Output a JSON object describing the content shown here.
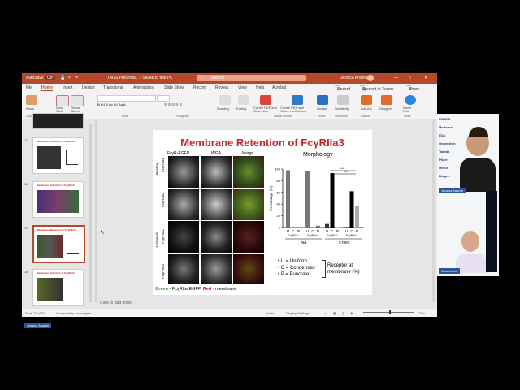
{
  "titlebar": {
    "autosave_label": "AutoSave",
    "autosave_state": "Off",
    "doc_title": "TAGS Presenta... • Saved to this PC",
    "search_placeholder": "Search",
    "user_name": "Jessica Anania"
  },
  "tabs": [
    "File",
    "Home",
    "Insert",
    "Design",
    "Transitions",
    "Animations",
    "Slide Show",
    "Record",
    "Review",
    "View",
    "Help",
    "Acrobat"
  ],
  "tab_buttons": {
    "record": "Record",
    "present": "Present in Teams",
    "share": "Share"
  },
  "ribbon": {
    "buttons": {
      "paste": "Paste",
      "new_slide": "New Slide",
      "reuse_slides": "Reuse Slides",
      "drawing": "Drawing",
      "editing": "Editing",
      "create_pdf_share": "Create PDF and Share link",
      "create_pdf_outlook": "Create PDF and Share via Outlook",
      "dictate": "Dictate",
      "sensitivity": "Sensitivity",
      "addins": "Add-ins",
      "designer": "Designer",
      "insert_poll": "Insert Poll"
    },
    "groups": [
      "Clipboard",
      "Slides",
      "Font",
      "Paragraph",
      "Adobe Acrobat",
      "Voice",
      "Sensitivity",
      "Add-ins",
      "Voice"
    ]
  },
  "thumbnails": [
    {
      "num": "11",
      "title": "Membrane Retention of FcγRIIa3"
    },
    {
      "num": "12",
      "title": "Membrane Retention of FcγRIIa3"
    },
    {
      "num": "13",
      "title": "Membrane Retention of FcγRIIa3"
    },
    {
      "num": "14",
      "title": "Membrane Retention of FcγRIIa3"
    }
  ],
  "slide": {
    "title": "Membrane Retention of FcγRIIa3",
    "col_headers": [
      "FcγR-EGFP",
      "WGA",
      "Merge"
    ],
    "row_groups": [
      "Resting",
      "Activated"
    ],
    "row_labels": [
      "FcγRIIa1",
      "FcγRIIa3",
      "FcγRIIa1",
      "FcγRIIa3"
    ],
    "caption_green": "Green",
    "caption_mid": " - FcγRIIa-EGFP, ",
    "caption_red": "Red",
    "caption_end": " - membrane",
    "chart_title": "Morphology",
    "legend": [
      "• U = Uniform",
      "• C = Condensed",
      "• P = Punctate"
    ],
    "legend_side": "Receptor at membrane (%)",
    "sig": "***"
  },
  "chart_data": {
    "type": "bar",
    "title": "Morphology",
    "ylabel": "Percentage (%)",
    "ylim": [
      0,
      100
    ],
    "yticks": [
      0,
      20,
      40,
      60,
      80,
      100
    ],
    "groups": [
      {
        "name": "FcγRIIa1",
        "condition": "NA",
        "categories": [
          "U",
          "C",
          "P"
        ],
        "values": [
          98,
          1,
          1
        ]
      },
      {
        "name": "FcγRIIa3",
        "condition": "NA",
        "categories": [
          "U",
          "C",
          "P"
        ],
        "values": [
          96,
          1,
          3
        ]
      },
      {
        "name": "FcγRIIa1",
        "condition": "5 min",
        "categories": [
          "U",
          "C",
          "P"
        ],
        "values": [
          6,
          93,
          1
        ]
      },
      {
        "name": "FcγRIIa3",
        "condition": "5 min",
        "categories": [
          "U",
          "C",
          "P"
        ],
        "values": [
          1,
          62,
          37
        ]
      }
    ],
    "condition_labels": [
      "NA",
      "5 min"
    ]
  },
  "canvas": {
    "notes_placeholder": "Click to add notes"
  },
  "statusbar": {
    "slide_info": "Slide 13 of 20",
    "accessibility": "Accessibility: Investigate",
    "notes": "Notes",
    "display": "Display Settings",
    "zoom": "72%"
  },
  "participants": [
    {
      "name": "Jessica Anania"
    },
    {
      "name": "Jessica Idé"
    }
  ],
  "self_label": "Jessica Anania",
  "sponsor_logos": [
    "UMASS",
    "Moderna",
    "FDA",
    "Genentech",
    "Takeda",
    "Pfizer",
    "Merck",
    "Biogen"
  ],
  "colors": {
    "accent": "#b7472a",
    "title_red": "#c0282d",
    "tag_blue": "#2b579a"
  }
}
